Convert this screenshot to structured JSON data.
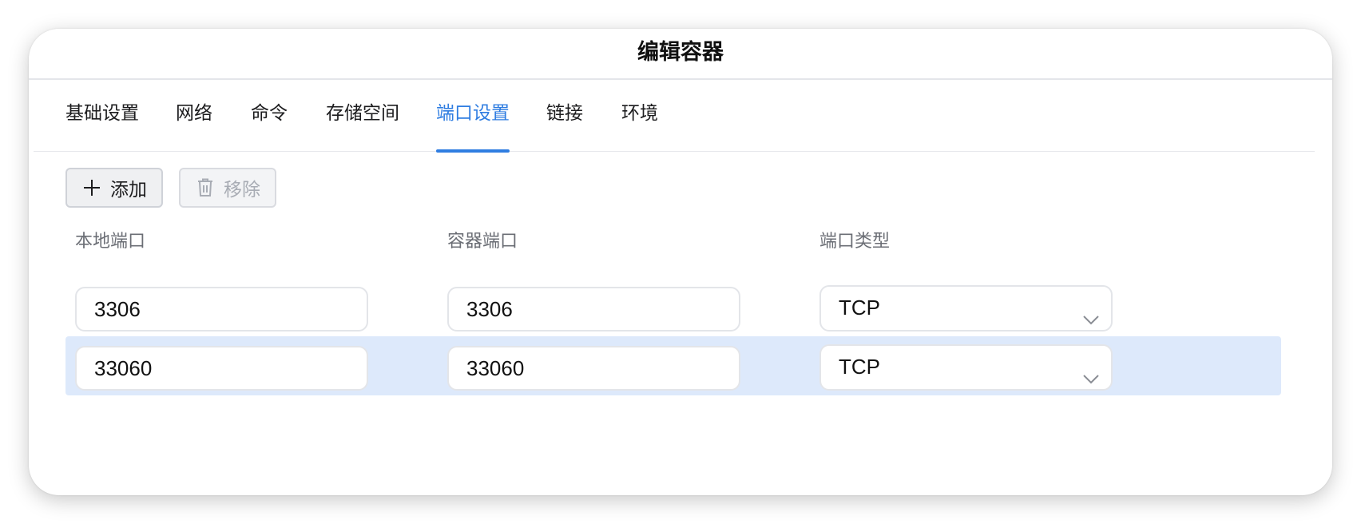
{
  "dialog": {
    "title": "编辑容器"
  },
  "tabs": [
    {
      "label": "基础设置",
      "active": false
    },
    {
      "label": "网络",
      "active": false
    },
    {
      "label": "命令",
      "active": false
    },
    {
      "label": "存储空间",
      "active": false
    },
    {
      "label": "端口设置",
      "active": true
    },
    {
      "label": "链接",
      "active": false
    },
    {
      "label": "环境",
      "active": false
    }
  ],
  "toolbar": {
    "add_label": "添加",
    "add_icon": "plus-icon",
    "remove_label": "移除",
    "remove_icon": "trash-icon",
    "remove_disabled": true
  },
  "table": {
    "columns": [
      "本地端口",
      "容器端口",
      "端口类型"
    ],
    "rows": [
      {
        "local_port": "3306",
        "container_port": "3306",
        "type": "TCP",
        "selected": false
      },
      {
        "local_port": "33060",
        "container_port": "33060",
        "type": "TCP",
        "selected": true
      }
    ]
  },
  "colors": {
    "accent": "#2f7de1",
    "selected_row": "#dde9fb"
  }
}
